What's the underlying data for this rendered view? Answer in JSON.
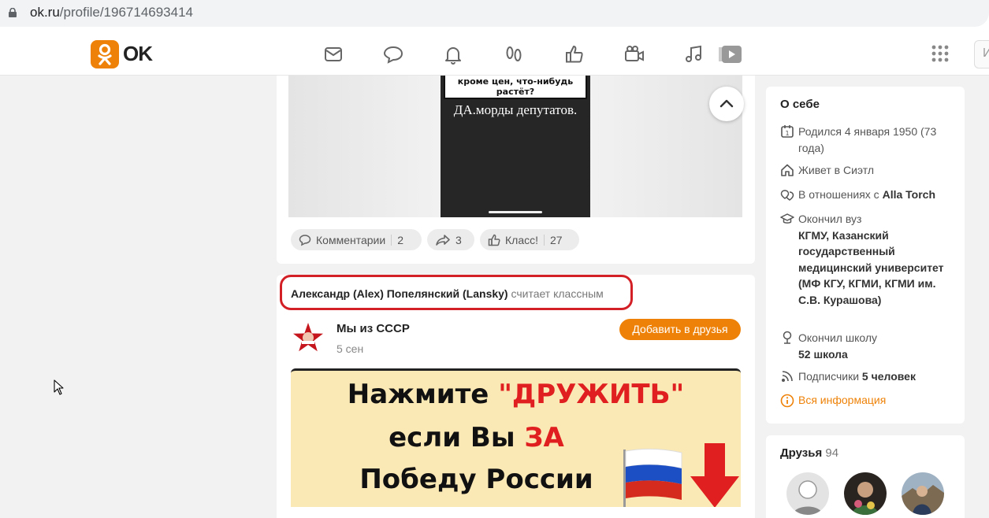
{
  "browser": {
    "url_host": "ok.ru",
    "url_path": "/profile/196714693414"
  },
  "header": {
    "logo_text": "OK",
    "nav_icons": [
      "messages-icon",
      "discussions-icon",
      "notifications-icon",
      "guests-icon",
      "reactions-icon",
      "friends-video-icon",
      "music-icon",
      "video-icon"
    ],
    "search_stub": "И"
  },
  "post1": {
    "meme_top": "кроме цен, что-нибудь растёт?",
    "meme_caption": "ДА.морды депутатов.",
    "comments_label": "Комментарии",
    "comments_count": "2",
    "shares_count": "3",
    "likes_label": "Класс!",
    "likes_count": "27"
  },
  "post2": {
    "actor_name": "Александр (Alex) Попелянский (Lansky)",
    "actor_action": "считает классным",
    "group_name": "Мы из СССР",
    "date": "5 сен",
    "add_friend_label": "Добавить в друзья",
    "banner_line1_a": "Нажмите ",
    "banner_line1_b": "\"ДРУЖИТЬ\"",
    "banner_line2_a": "если Вы ",
    "banner_line2_b": "ЗА",
    "banner_line3": "Победу России"
  },
  "about": {
    "title": "О себе",
    "born": "Родился 4 января 1950 (73 года)",
    "lives": "Живет в Сиэтл",
    "relation_prefix": "В отношениях с ",
    "relation_name": "Alla Torch",
    "uni_prefix": "Окончил вуз",
    "uni_name": "КГМУ, Казанский государственный медицинский университет (МФ КГУ, КГМИ, КГМИ им. С.В. Курашова)",
    "school_prefix": "Окончил школу",
    "school_name": "52 школа",
    "subs_prefix": "Подписчики ",
    "subs_value": "5 человек",
    "all_info": "Вся информация"
  },
  "friends": {
    "title": "Друзья",
    "count": "94"
  },
  "colors": {
    "accent": "#ee8208",
    "highlight_border": "#d32027"
  }
}
